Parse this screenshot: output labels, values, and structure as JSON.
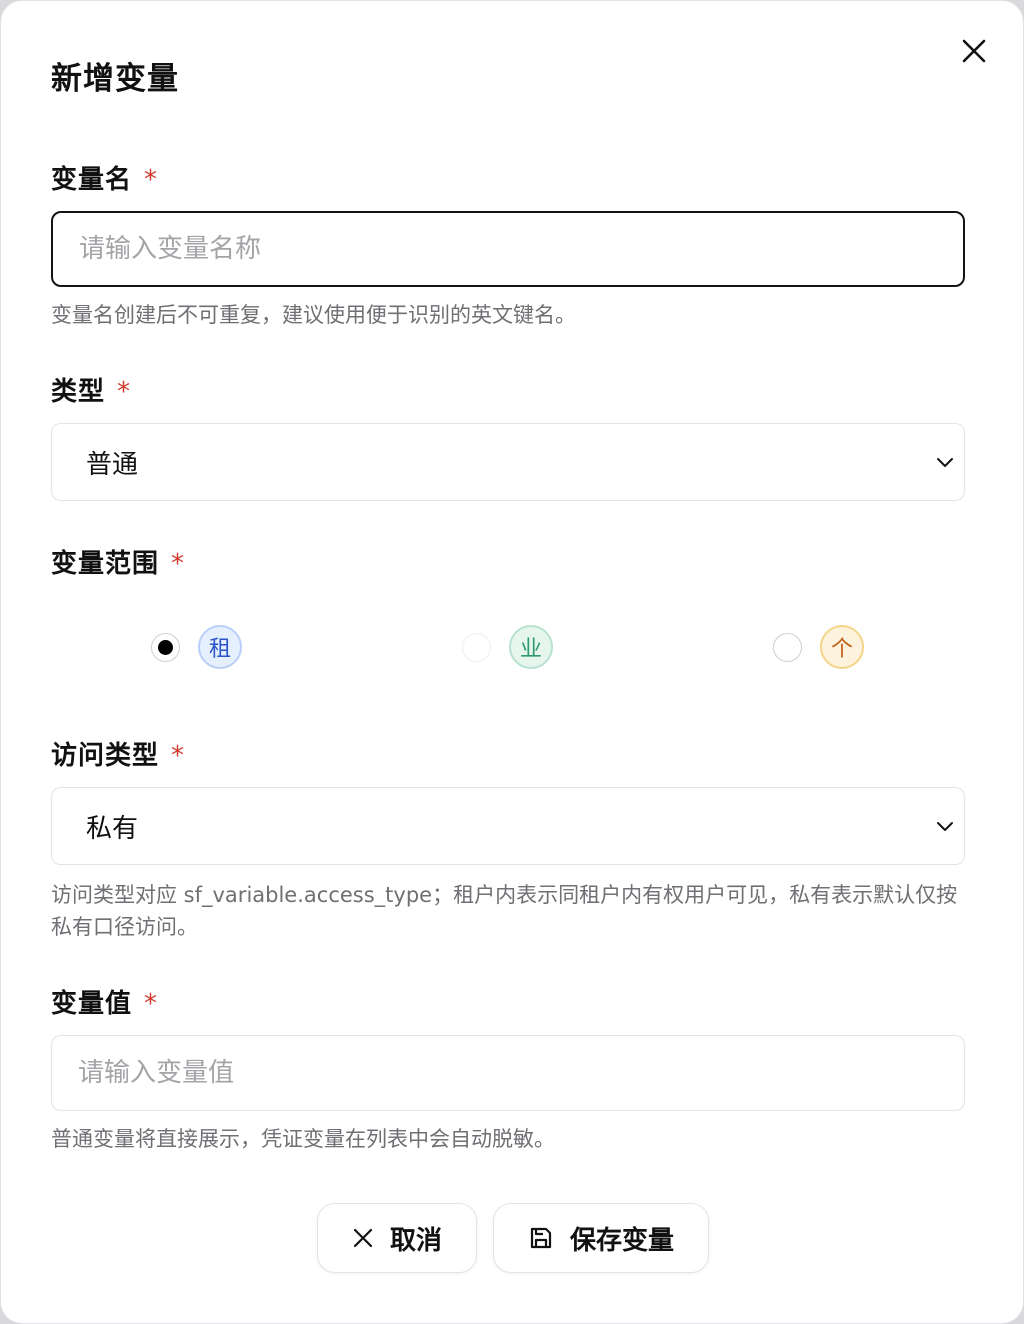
{
  "dialog": {
    "title": "新增变量",
    "close_icon": "close-icon"
  },
  "name_field": {
    "label": "变量名",
    "required_mark": "*",
    "value": "",
    "placeholder": "请输入变量名称",
    "hint": "变量名创建后不可重复，建议使用便于识别的英文键名。"
  },
  "type_field": {
    "label": "类型",
    "required_mark": "*",
    "selected": "普通",
    "chevron_icon": "chevron-down-icon"
  },
  "scope_field": {
    "label": "变量范围",
    "required_mark": "*",
    "options": [
      {
        "badge": "租",
        "checked": true,
        "color": "#2a55c8"
      },
      {
        "badge": "业",
        "checked": false,
        "color": "#2c9a6c"
      },
      {
        "badge": "个",
        "checked": false,
        "color": "#c0621c"
      }
    ]
  },
  "access_field": {
    "label": "访问类型",
    "required_mark": "*",
    "selected": "私有",
    "chevron_icon": "chevron-down-icon",
    "hint": "访问类型对应 sf_variable.access_type；租户内表示同租户内有权用户可见，私有表示默认仅按私有口径访问。"
  },
  "value_field": {
    "label": "变量值",
    "required_mark": "*",
    "value": "",
    "placeholder": "请输入变量值",
    "hint": "普通变量将直接展示，凭证变量在列表中会自动脱敏。"
  },
  "actions": {
    "cancel_label": "取消",
    "cancel_icon": "x-icon",
    "save_label": "保存变量",
    "save_icon": "save-icon"
  },
  "colors": {
    "required": "#d33a2c",
    "hint_text": "#6f6f74",
    "border": "#e3e3e6",
    "focus_border": "#141414"
  }
}
